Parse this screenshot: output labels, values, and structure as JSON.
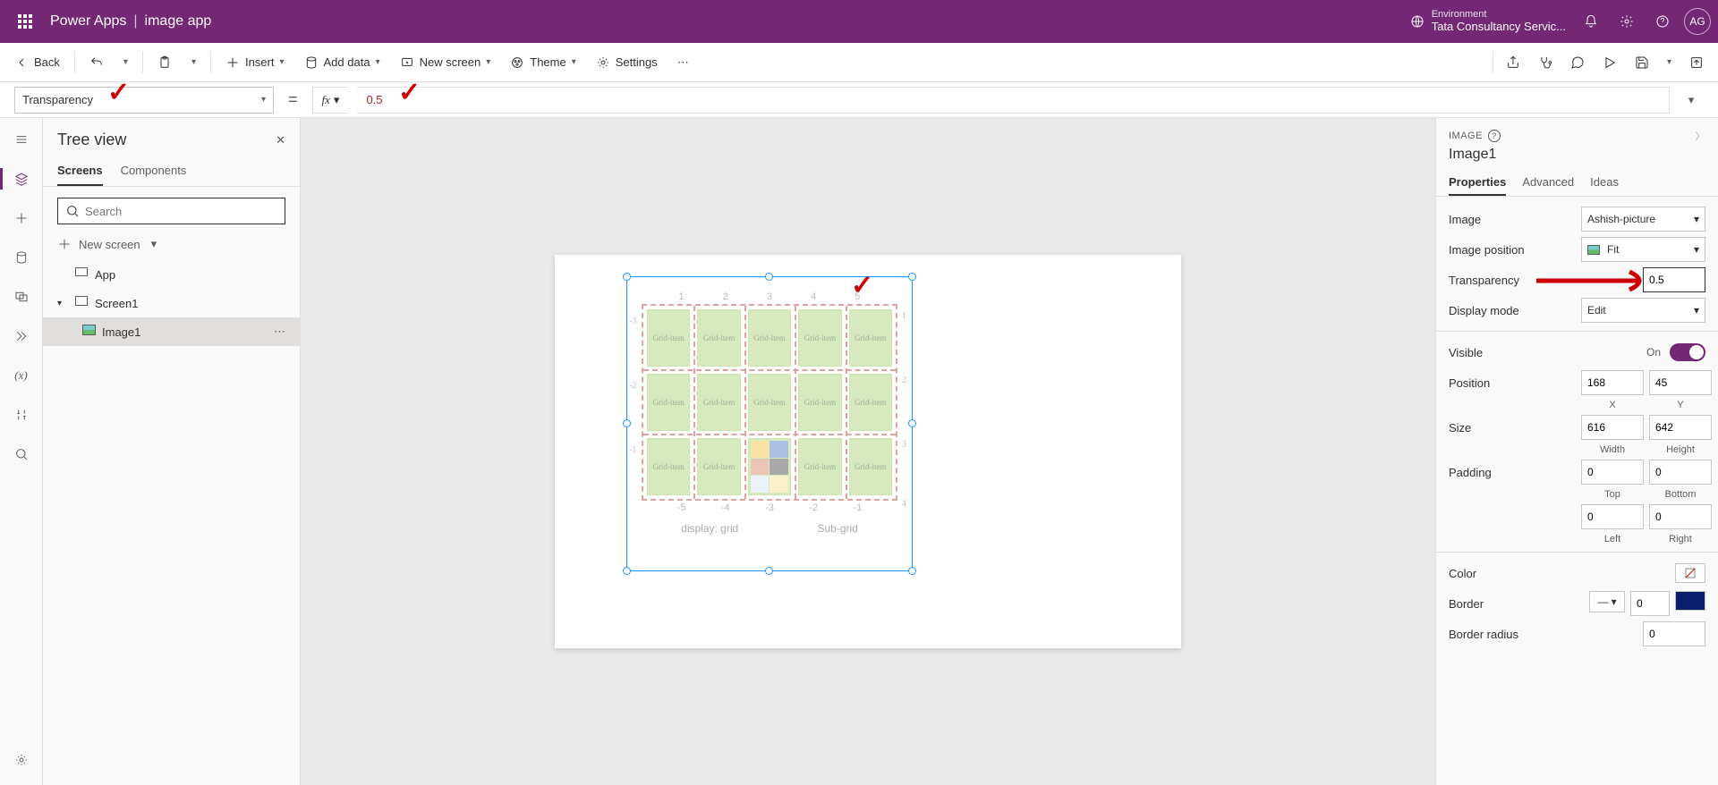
{
  "header": {
    "product": "Power Apps",
    "separator": "|",
    "app_name": "image app",
    "environment_label": "Environment",
    "environment_value": "Tata Consultancy Servic...",
    "avatar_initials": "AG"
  },
  "ribbon": {
    "back": "Back",
    "insert": "Insert",
    "add_data": "Add data",
    "new_screen": "New screen",
    "theme": "Theme",
    "settings": "Settings"
  },
  "formula": {
    "property": "Transparency",
    "equals": "=",
    "fx": "fx",
    "value": "0.5"
  },
  "tree": {
    "title": "Tree view",
    "tab_screens": "Screens",
    "tab_components": "Components",
    "search_placeholder": "Search",
    "new_screen": "New screen",
    "app": "App",
    "screen1": "Screen1",
    "image1": "Image1"
  },
  "canvas": {
    "grid_item": "Grid-item",
    "display_grid": "display: grid",
    "sub_grid": "Sub-grid",
    "cols": [
      "1",
      "2",
      "3",
      "4",
      "5"
    ],
    "rows_left": [
      "-3",
      "-2",
      "-1"
    ],
    "rows_right": [
      "1",
      "2",
      "3",
      "4"
    ],
    "bottom": [
      "-5",
      "-4",
      "-3",
      "-2",
      "-1"
    ]
  },
  "props": {
    "type_label": "IMAGE",
    "element_name": "Image1",
    "tab_properties": "Properties",
    "tab_advanced": "Advanced",
    "tab_ideas": "Ideas",
    "image_label": "Image",
    "image_value": "Ashish-picture",
    "image_position_label": "Image position",
    "image_position_value": "Fit",
    "transparency_label": "Transparency",
    "transparency_value": "0.5",
    "display_mode_label": "Display mode",
    "display_mode_value": "Edit",
    "visible_label": "Visible",
    "visible_on": "On",
    "position_label": "Position",
    "position_x": "168",
    "position_y": "45",
    "x": "X",
    "y": "Y",
    "size_label": "Size",
    "size_w": "616",
    "size_h": "642",
    "w": "Width",
    "h": "Height",
    "padding_label": "Padding",
    "pad_t": "0",
    "pad_b": "0",
    "pad_l": "0",
    "pad_r": "0",
    "top": "Top",
    "bottom": "Bottom",
    "left": "Left",
    "right": "Right",
    "color_label": "Color",
    "border_label": "Border",
    "border_width": "0",
    "border_radius_label": "Border radius",
    "border_radius": "0"
  }
}
